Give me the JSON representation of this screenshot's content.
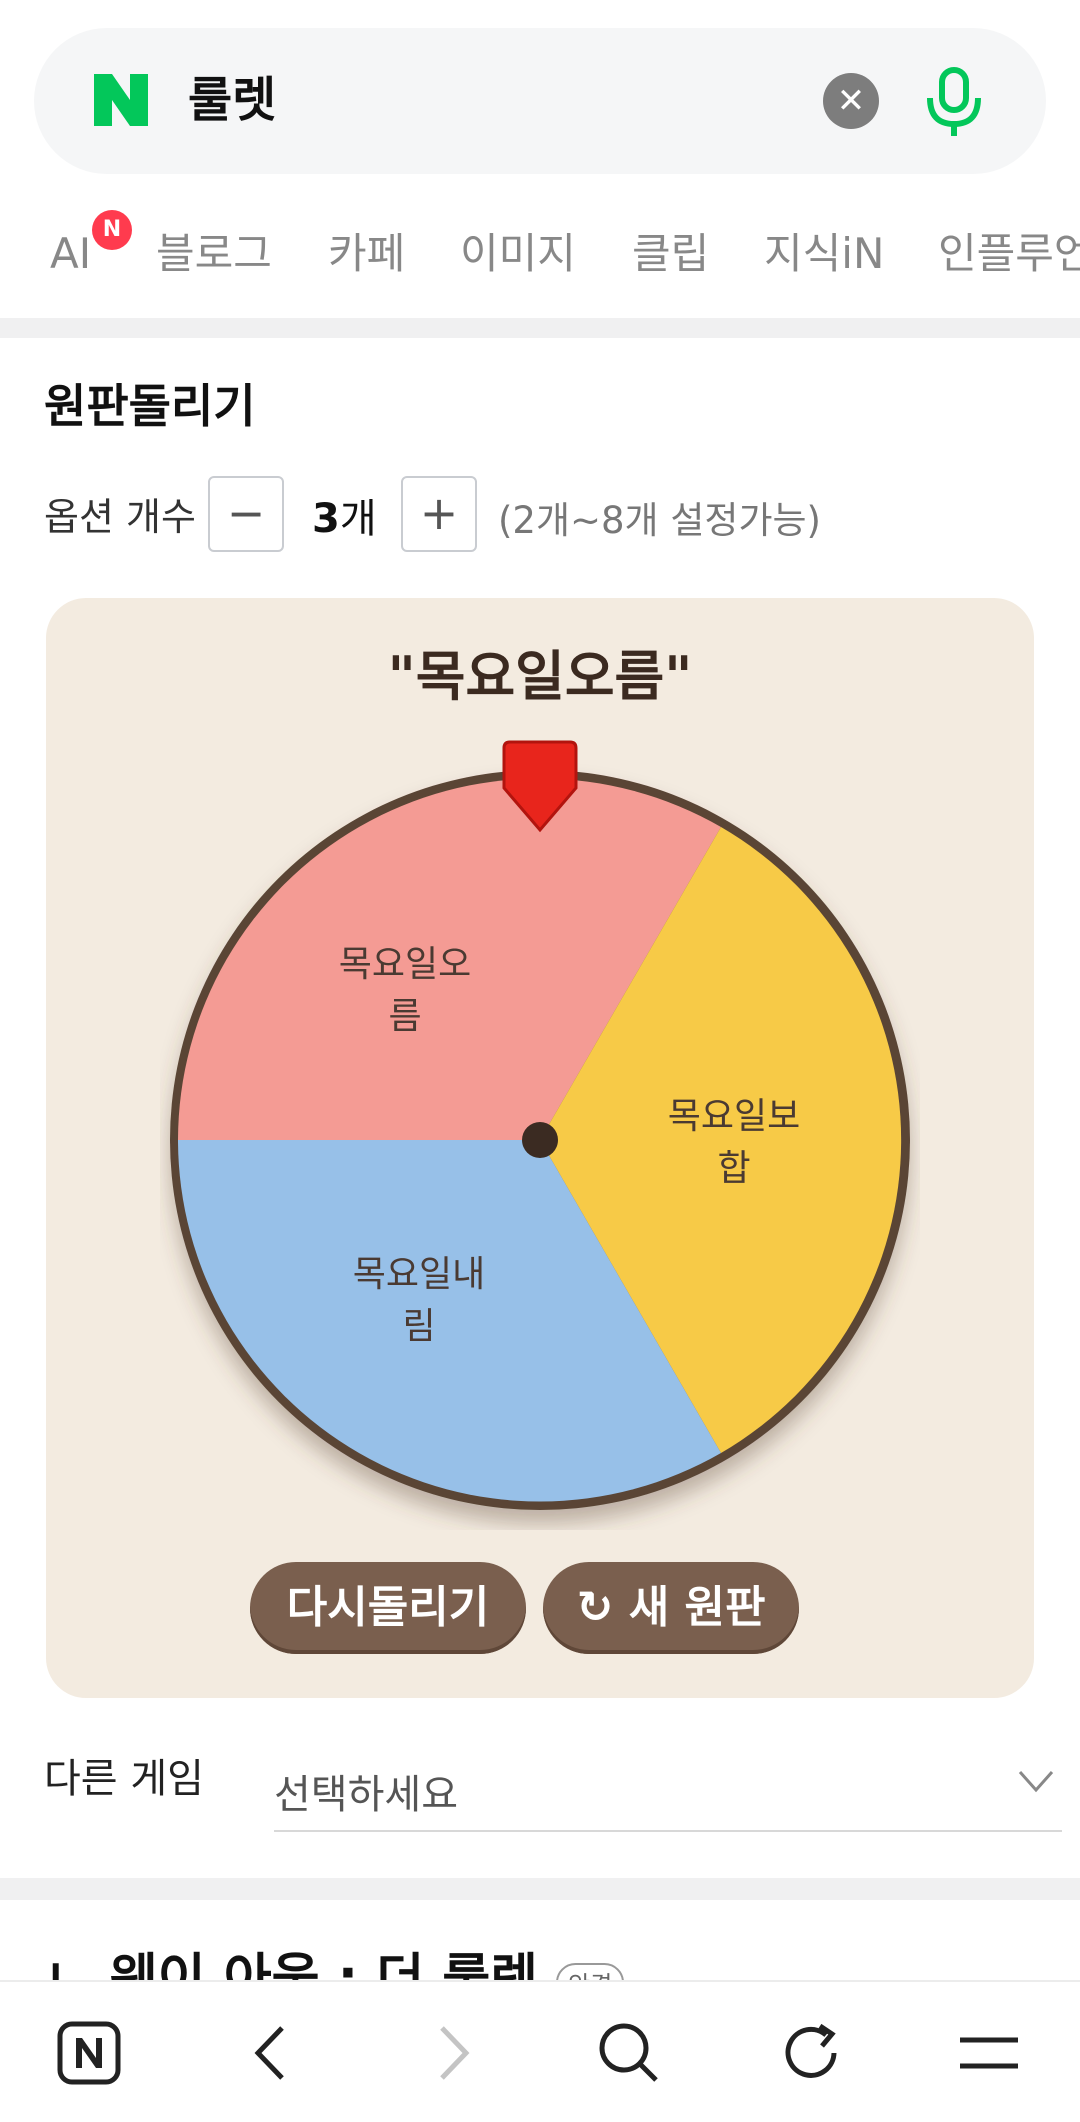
{
  "search": {
    "logo_letter": "N",
    "query": "룰렛",
    "clear_icon": "close-icon",
    "mic_icon": "mic-icon"
  },
  "tabs": [
    {
      "label": "AI",
      "badge": "N"
    },
    {
      "label": "블로그"
    },
    {
      "label": "카페"
    },
    {
      "label": "이미지"
    },
    {
      "label": "클립"
    },
    {
      "label": "지식iN"
    },
    {
      "label": "인플루언"
    }
  ],
  "roulette": {
    "title": "원판돌리기",
    "option_label": "옵션 개수",
    "minus": "−",
    "plus": "+",
    "count_num": "3",
    "count_unit": "개",
    "range_note": "(2개~8개 설정가능)",
    "result": "\"목요일오름\"",
    "segments": [
      {
        "line1": "목요일오",
        "line2": "름",
        "color": "#f49b94"
      },
      {
        "line1": "목요일보",
        "line2": "합",
        "color": "#f7ca47"
      },
      {
        "line1": "목요일내",
        "line2": "림",
        "color": "#97c0e8"
      }
    ],
    "spin_again": "다시돌리기",
    "new_wheel": "새 원판"
  },
  "other_game": {
    "label": "다른 게임",
    "select_value": "선택하세요"
  },
  "next_section": {
    "title_partial": "ㄴ 웨이 아웃 : 더 룰렛",
    "badge": "안경"
  },
  "bottom_nav": [
    "naver-home-icon",
    "back-icon",
    "forward-icon",
    "search-icon",
    "refresh-icon",
    "menu-icon"
  ],
  "colors": {
    "brand_green": "#03c75a",
    "button_brown": "#7a5f4e",
    "card_bg": "#f3ebe0",
    "pointer_red": "#e8251c"
  }
}
